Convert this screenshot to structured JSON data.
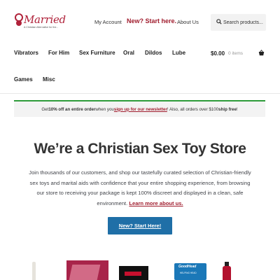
{
  "brand": {
    "name": "Married",
    "tagline": "A Christian Alternative for the..."
  },
  "top_links": {
    "account": "My Account",
    "new": "New? Start here.",
    "about": "About Us"
  },
  "search": {
    "placeholder": "Search products..."
  },
  "nav": {
    "items": [
      "Vibrators",
      "For Him",
      "Sex Furniture",
      "Oral",
      "Dildos",
      "Lube",
      "Games",
      "Misc"
    ]
  },
  "cart": {
    "amount": "$0.00",
    "items": "0 items"
  },
  "notice": {
    "pre": "Get ",
    "bold": "10% off an entire order",
    "mid": " when you ",
    "link": "sign up for our newsletter",
    "post": "! Also, all orders over $100 ",
    "bold2": "ship free",
    "end": "!"
  },
  "hero": {
    "title": "We’re a Christian Sex Toy Store",
    "text": "Join thousands of our customers, and shop our tastefully curated selection of Christian-friendly sex toys and marital aids with confidence that your entire shopping experience, from browsing our store to receiving your package is kept 100% discreet and displayed in a clean, safe environment. ",
    "link": "Learn more about us.",
    "cta": "New? Start Here!"
  },
  "products": {
    "p4_label": "GoodHead",
    "p4_sub": "HELPING HEAD"
  },
  "colors": {
    "accent": "#a01c2d",
    "notice_border": "#2d9b3a",
    "cta": "#1f6fa7"
  }
}
